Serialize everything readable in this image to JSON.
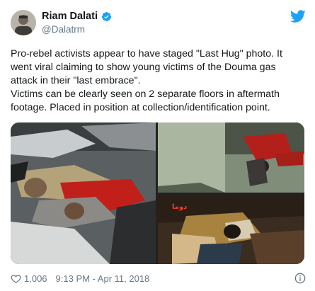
{
  "tweet": {
    "author": {
      "display_name": "Riam Dalati",
      "handle": "@Dalatrm",
      "verified": true
    },
    "text_lines": [
      "Pro-rebel activists appear to have staged \"Last Hug\" photo. It went viral claiming to show young victims of the Douma gas attack in their \"last embrace\".",
      "Victims can be clearly seen on 2 separate floors in aftermath footage. Placed in position at collection/identification point."
    ],
    "media": {
      "overlay_text": "دوما"
    },
    "footer": {
      "like_count": "1,006",
      "timestamp": "9:13 PM - Apr 11, 2018"
    }
  },
  "colors": {
    "twitter_blue": "#1da1f2",
    "secondary_text": "#657786",
    "primary_text": "#14171a"
  },
  "icons": {
    "brand": "twitter-bird-icon",
    "verified": "verified-badge-icon",
    "like": "heart-icon",
    "info": "info-icon"
  }
}
